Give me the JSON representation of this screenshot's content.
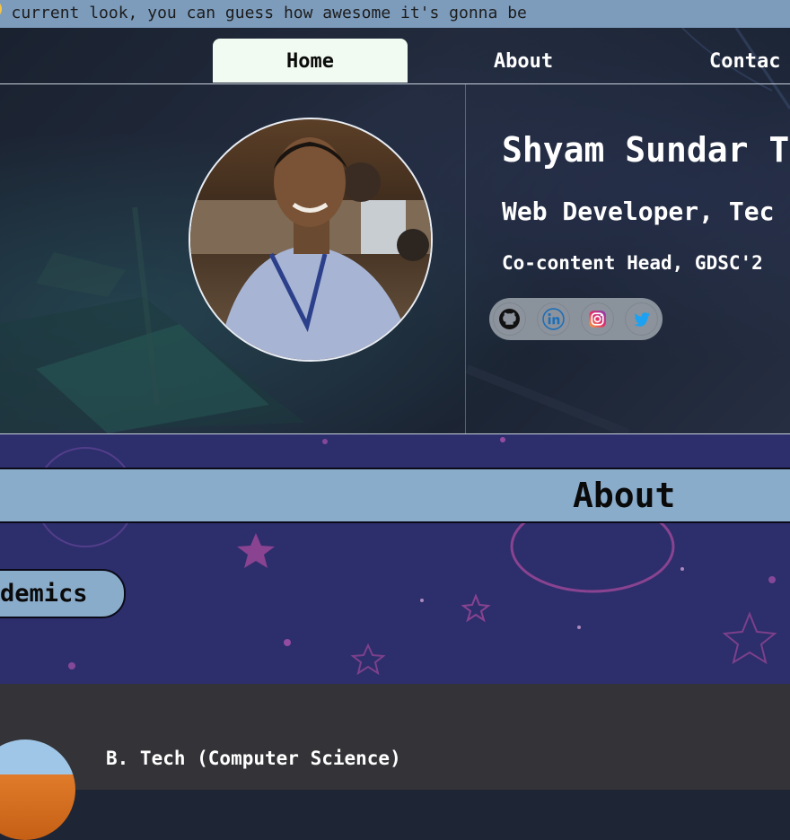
{
  "marquee": {
    "text": "'s current look, you can guess how awesome it's gonna be"
  },
  "nav": {
    "home": "Home",
    "about": "About",
    "contact": "Contac"
  },
  "hero": {
    "name": "Shyam Sundar T",
    "role": "Web Developer, Tec",
    "sub": "Co-content Head, GDSC'2",
    "socials": [
      "github-icon",
      "linkedin-icon",
      "instagram-icon",
      "twitter-icon"
    ]
  },
  "about": {
    "title": "About",
    "academics_label": "demics"
  },
  "education": {
    "degree": "B. Tech (Computer Science)"
  },
  "colors": {
    "banner": "#7d9cbc",
    "active_tab": "#f2fbf1",
    "section_bar": "#8aaccb",
    "space_bg": "#2d2e6c",
    "lower_bg": "#343438"
  }
}
